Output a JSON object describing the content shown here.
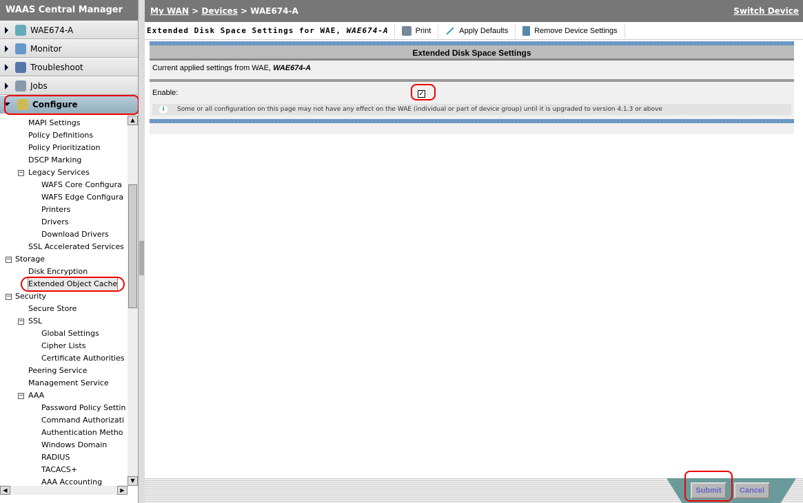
{
  "app": {
    "title": "WAAS Central Manager"
  },
  "nav": [
    {
      "label": "WAE674-A",
      "color": "#6ab"
    },
    {
      "label": "Monitor",
      "color": "#69c"
    },
    {
      "label": "Troubleshoot",
      "color": "#57a"
    },
    {
      "label": "Jobs",
      "color": "#89a"
    },
    {
      "label": "Configure",
      "color": "#cb5"
    }
  ],
  "tree": [
    {
      "label": "MAPI Settings",
      "level": 1
    },
    {
      "label": "Policy Definitions",
      "level": 1
    },
    {
      "label": "Policy Prioritization",
      "level": 1
    },
    {
      "label": "DSCP Marking",
      "level": 1
    },
    {
      "label": "Legacy Services",
      "level": 1,
      "expander": "⊟"
    },
    {
      "label": "WAFS Core Configura",
      "level": 2
    },
    {
      "label": "WAFS Edge Configura",
      "level": 2
    },
    {
      "label": "Printers",
      "level": 2
    },
    {
      "label": "Drivers",
      "level": 2
    },
    {
      "label": "Download Drivers",
      "level": 2
    },
    {
      "label": "SSL Accelerated Services",
      "level": 1
    },
    {
      "label": "Storage",
      "level": 0,
      "expander": "⊟"
    },
    {
      "label": "Disk Encryption",
      "level": 1
    },
    {
      "label": "Extended Object Cache",
      "level": 1,
      "selected": true
    },
    {
      "label": "Security",
      "level": 0,
      "expander": "⊟"
    },
    {
      "label": "Secure Store",
      "level": 1
    },
    {
      "label": "SSL",
      "level": 1,
      "expander": "⊟"
    },
    {
      "label": "Global Settings",
      "level": 2
    },
    {
      "label": "Cipher Lists",
      "level": 2
    },
    {
      "label": "Certificate Authorities",
      "level": 2
    },
    {
      "label": "Peering Service",
      "level": 1
    },
    {
      "label": "Management Service",
      "level": 1
    },
    {
      "label": "AAA",
      "level": 1,
      "expander": "⊟"
    },
    {
      "label": "Password Policy Settin",
      "level": 2
    },
    {
      "label": "Command Authorizati",
      "level": 2
    },
    {
      "label": "Authentication Metho",
      "level": 2
    },
    {
      "label": "Windows Domain",
      "level": 2
    },
    {
      "label": "RADIUS",
      "level": 2
    },
    {
      "label": "TACACS+",
      "level": 2
    },
    {
      "label": "AAA Accounting",
      "level": 2
    }
  ],
  "breadcrumb": {
    "items": [
      "My WAN",
      "Devices",
      "WAE674-A"
    ],
    "sep": ">",
    "switch": "Switch Device"
  },
  "toolbar": {
    "title": "Extended Disk Space Settings for WAE, ",
    "device": "WAE674-A",
    "print": "Print",
    "apply": "Apply Defaults",
    "remove": "Remove Device Settings"
  },
  "panel": {
    "header": "Extended Disk Space Settings",
    "current": "Current applied settings from WAE, ",
    "device": "WAE674-A",
    "enable_label": "Enable:",
    "enable_checked": true,
    "info": "Some or all configuration on this page may not have any effect on the WAE (individual or part of device group) until it is upgraded to version 4.1.3 or above"
  },
  "footer": {
    "submit": "Submit",
    "cancel": "Cancel"
  }
}
